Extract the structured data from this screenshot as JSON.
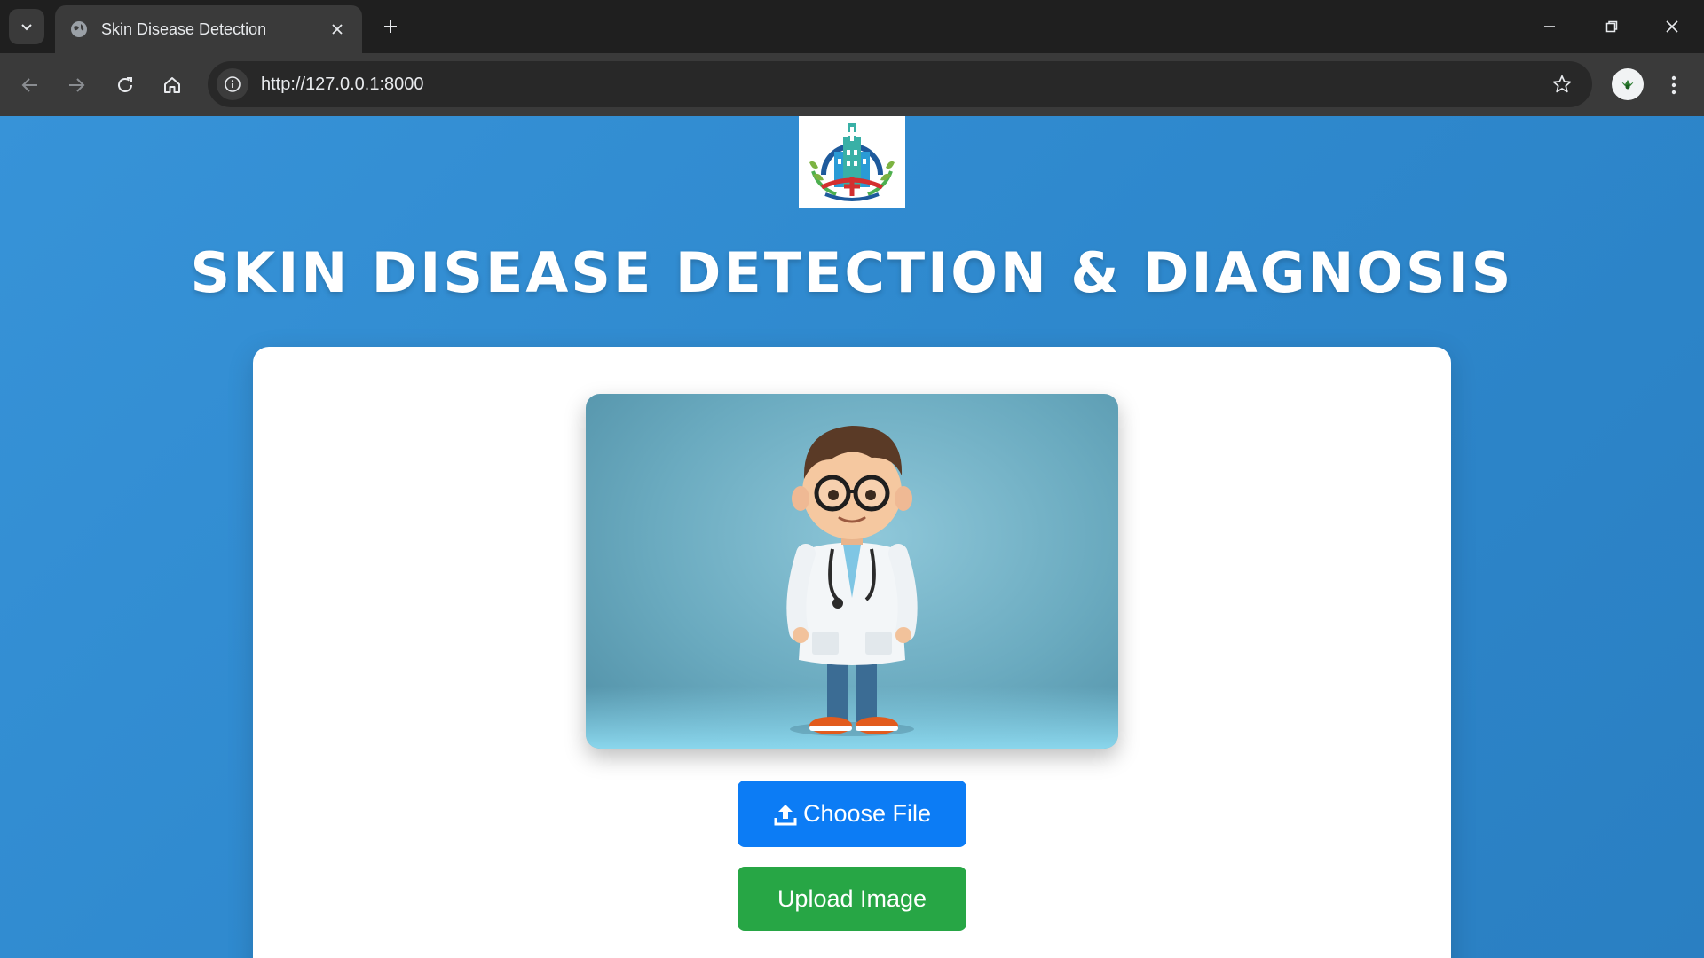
{
  "browser": {
    "tab": {
      "title": "Skin Disease Detection",
      "favicon": "globe-icon"
    },
    "omnibox": {
      "url": "http://127.0.0.1:8000"
    },
    "icons": [
      "chevron-down-icon",
      "close-icon",
      "plus-icon",
      "minimize-icon",
      "restore-icon",
      "back-arrow-icon",
      "forward-arrow-icon",
      "reload-icon",
      "home-icon",
      "info-icon",
      "star-icon",
      "profile-avatar",
      "more-vert-icon"
    ]
  },
  "page": {
    "title": "SKIN DISEASE DETECTION & DIAGNOSIS",
    "logo": "hospital-logo",
    "hero_image": "cartoon-doctor-illustration",
    "choose_file_label": "Choose File",
    "upload_label": "Upload Image",
    "colors": {
      "background": "#3190d5",
      "choose_button": "#0c7cf5",
      "upload_button": "#27a645"
    }
  }
}
